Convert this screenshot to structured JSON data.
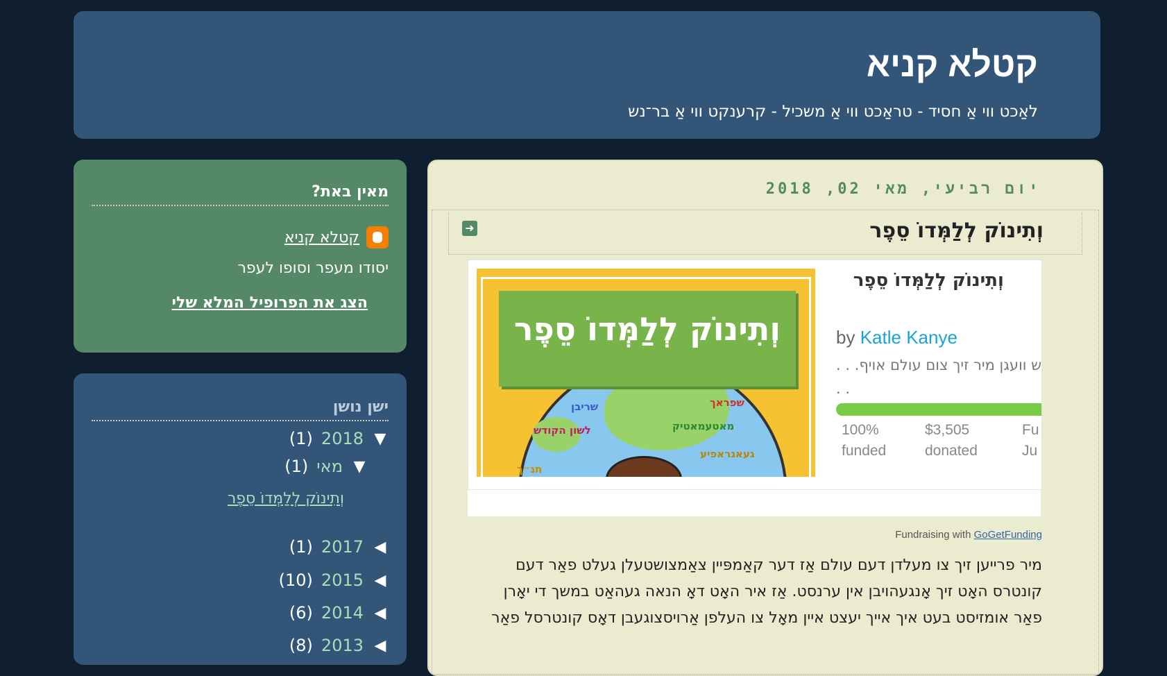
{
  "header": {
    "title": "קטלא קניא",
    "description": "לאַכט ווי אַ חסיד - טראַכט ווי אַ משכיל - קרענקט ווי אַ בר־נש"
  },
  "profile": {
    "title": "מאין באת?",
    "name": "קטלא קניא",
    "about": "יסודו מעפר וסופו לעפר",
    "full_profile_link": "הצג את הפרופיל המלא שלי"
  },
  "archive": {
    "title": "ישן נושן",
    "years": [
      {
        "label": "2018",
        "count": "(1)",
        "expanded": true
      },
      {
        "label": "2017",
        "count": "(1)",
        "expanded": false
      },
      {
        "label": "2015",
        "count": "(10)",
        "expanded": false
      },
      {
        "label": "2014",
        "count": "(6)",
        "expanded": false
      },
      {
        "label": "2013",
        "count": "(8)",
        "expanded": false
      }
    ],
    "month": {
      "label": "מאי",
      "count": "(1)"
    },
    "post": "וְתִינוֹק לְלַמְּדוֹ סֵפֶר"
  },
  "post": {
    "date": "יום רביעי, מאי 02, 2018",
    "title": "וְתִינוֹק לְלַמְּדוֹ סֵפֶר",
    "embed": {
      "title": "וְתִינוֹק לְלַמְּדוֹ סֵפֶר",
      "image_text": "וְתִינוֹק לְלַמְּדוֹ סֵפֶר",
      "globe_labels": [
        "שריבן",
        "שפראך",
        "לשון הקודש",
        "מאטעמאטיק",
        "געאגראפיע",
        "תנ״ך"
      ],
      "by": "by",
      "author": "Katle Kanye",
      "desc": "הל הקודש וועגן מיר זיך צום עולם אויף. . . . .",
      "progress": 1.0,
      "stats": [
        {
          "value": "100%",
          "label": "funded"
        },
        {
          "value": "$3,505",
          "label": "donated"
        },
        {
          "value": "Fu",
          "label": "Ju"
        }
      ]
    },
    "fundraising_prefix": "Fundraising with",
    "fundraising_link": "GoGetFunding",
    "body": [
      "מיר פרייען זיך צו מעלדן דעם עולם אַז דער קאַמפּיין צאַמצושטעלן געלט פאַר דעם",
      "קונטרס האָט זיך אָנגעהויבן אין ערנסט. אַז איר האָט דאָ הנאה געהאַט במשך די יאָרן",
      "פאַר אומזיסט בעט איך אייך יעצט איין מאָל צו העלפן אַרויסצוגעבן דאָס קונטרסל פאַר"
    ]
  },
  "colors": {
    "page_bg": "#0f1f30",
    "header_bg": "#335577",
    "profile_bg": "#558866",
    "main_bg": "#ebebd0",
    "link_green": "#aaddbb",
    "accent_green": "#77cc44"
  }
}
